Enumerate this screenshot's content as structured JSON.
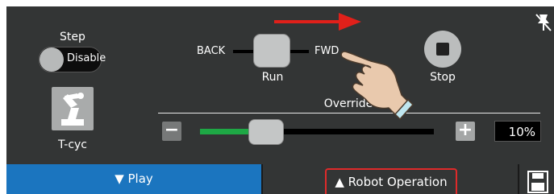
{
  "step": {
    "title": "Step",
    "state": "Disable"
  },
  "tcyc": {
    "label": "T-cyc",
    "icon": "robot-arm-icon"
  },
  "jog": {
    "back_label": "BACK",
    "fwd_label": "FWD",
    "run_label": "Run"
  },
  "stop": {
    "label": "Stop",
    "icon": "stop-icon"
  },
  "override": {
    "label": "Override",
    "value_text": "10%",
    "level_fraction": 0.2,
    "minus": "−",
    "plus": "+"
  },
  "tabs": {
    "play_label": "▼ Play",
    "robot_operation_label": "▲ Robot Operation"
  },
  "icons": {
    "top_right": "pin-off-icon",
    "save": "save-icon",
    "hand": "pointing-hand-icon",
    "direction_arrow": "arrow-right-icon"
  },
  "colors": {
    "background": "#333535",
    "play_tab": "#1b75bf",
    "highlight": "#e02a2a",
    "slider_fill": "#1ea845",
    "arrow": "#e0201a"
  }
}
